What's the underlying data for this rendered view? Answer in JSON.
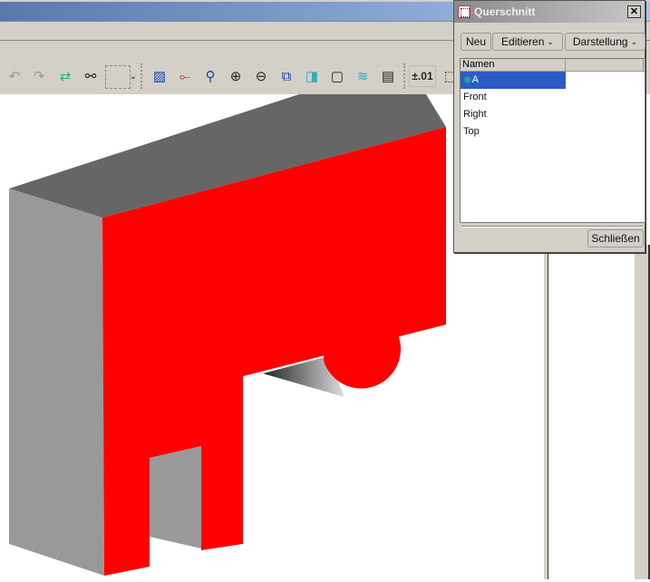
{
  "toolbar": {
    "icons": [
      "undo-icon",
      "redo-icon",
      "regenerate-icon",
      "find-icon",
      "select-box-icon",
      "view-icon",
      "datum-icon",
      "spin-zoom-icon",
      "zoom-in-icon",
      "zoom-out-icon",
      "refit-icon",
      "orient-icon",
      "saved-views-icon",
      "layers-icon",
      "model-tree-icon",
      "tolerance-icon"
    ],
    "tolerance_label": "±.01"
  },
  "dialog": {
    "title": "Querschnitt",
    "close": "✕",
    "new_label": "Neu",
    "edit_label": "Editieren",
    "display_label": "Darstellung",
    "column_header": "Namen",
    "items": [
      "A",
      "Front",
      "Right",
      "Top"
    ],
    "selected": "A",
    "close_button": "Schließen"
  },
  "colors": {
    "section": "#ff0000",
    "top_face": "#666666",
    "side_face": "#999999",
    "selection": "#2c5bc5"
  }
}
